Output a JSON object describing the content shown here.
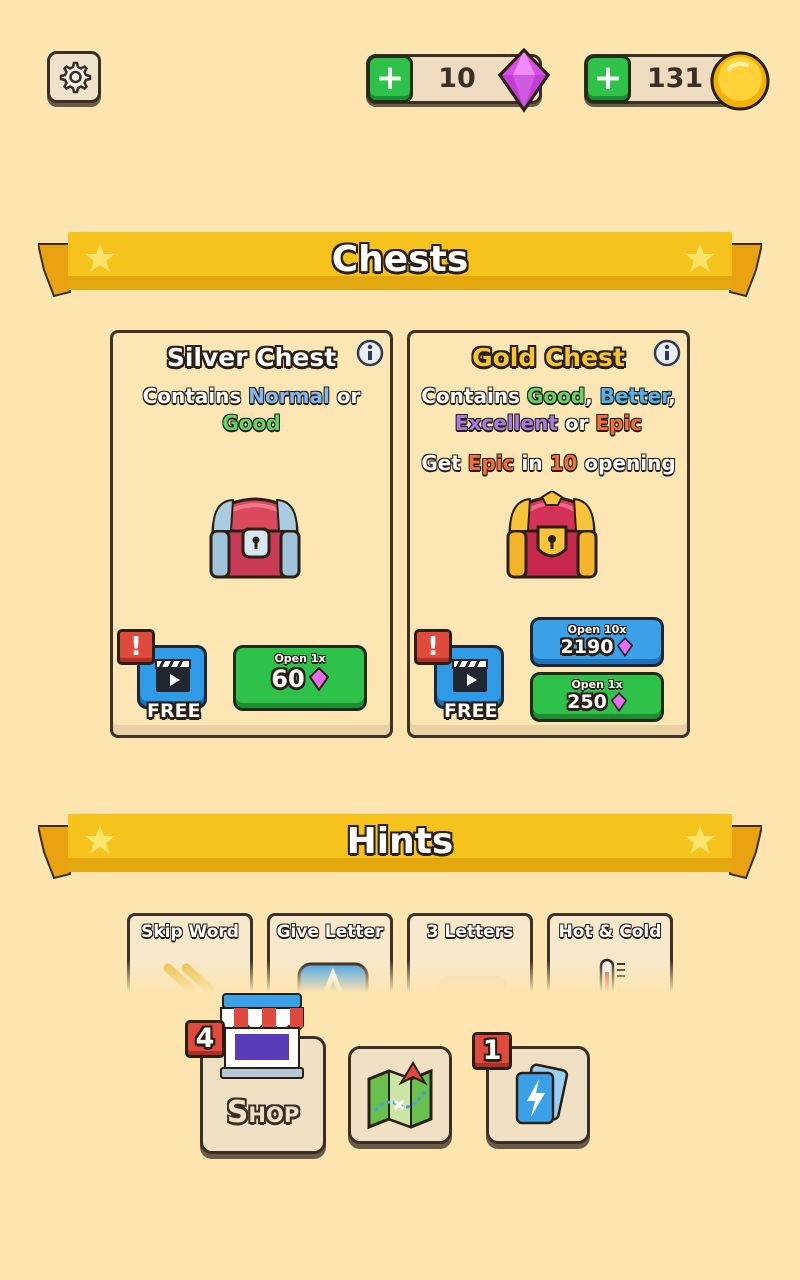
{
  "topbar": {
    "settings_icon": "gear-icon",
    "gems": {
      "plus_label": "+",
      "amount": "10",
      "icon": "gem-icon"
    },
    "coins": {
      "plus_label": "+",
      "amount": "131",
      "icon": "coin-icon"
    }
  },
  "chests_section": {
    "title": "Chests",
    "silver": {
      "title": "Silver Chest",
      "desc_prefix": "Contains ",
      "desc_normal": "Normal",
      "desc_or": " or",
      "desc_good": "Good",
      "free_label": "FREE",
      "alert": "!",
      "open_label": "Open 1x",
      "price": "60"
    },
    "gold": {
      "title": "Gold Chest",
      "desc_prefix": "Contains ",
      "desc_good": "Good",
      "desc_comma1": ", ",
      "desc_better": "Better",
      "desc_comma2": ",",
      "desc_excellent": "Excellent",
      "desc_or": " or ",
      "desc_epic": "Epic",
      "note_prefix": "Get ",
      "note_epic": "Epic",
      "note_in": " in ",
      "note_count": "10",
      "note_suffix": " opening",
      "free_label": "FREE",
      "alert": "!",
      "open10_label": "Open 10x",
      "open10_price": "2190",
      "open1_label": "Open 1x",
      "open1_price": "250"
    },
    "colors": {
      "normal": "#7FB8F2",
      "good": "#5ED66A",
      "better": "#4FB3F0",
      "excellent": "#A77AE6",
      "epic": "#F0703C",
      "gold_title": "#F7C531"
    }
  },
  "hints_section": {
    "title": "Hints",
    "items": [
      "Skip Word",
      "Give Letter",
      "3 Letters",
      "Hot & Cold"
    ]
  },
  "bottom_nav": {
    "shop": {
      "label": "Shop",
      "badge": "4"
    },
    "map": {
      "icon": "map-icon"
    },
    "cards": {
      "badge": "1",
      "icon": "cards-icon"
    }
  }
}
